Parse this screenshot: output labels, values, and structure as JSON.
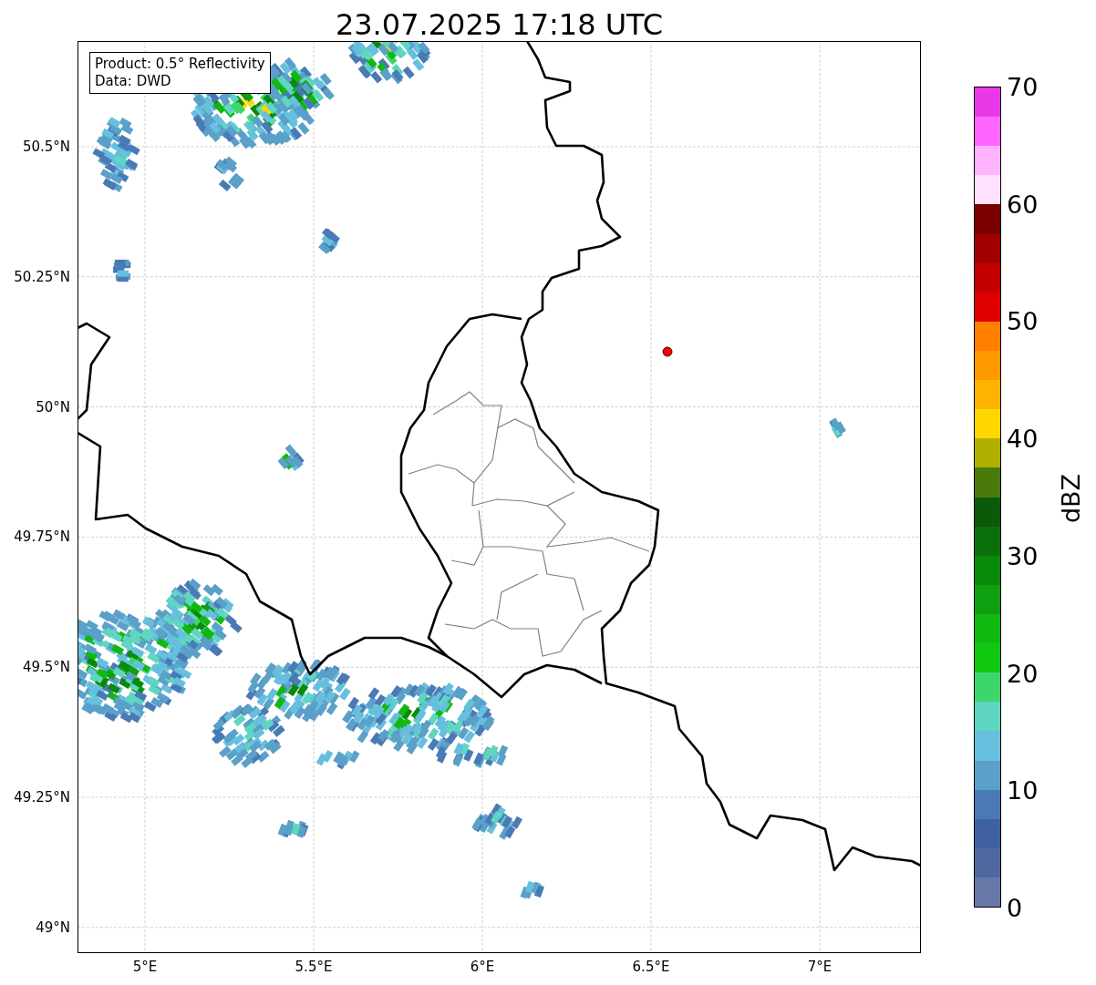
{
  "title": "23.07.2025 17:18 UTC",
  "info_box": [
    "Product: 0.5° Reflectivity",
    "Data: DWD"
  ],
  "map": {
    "yticks": [
      "50.5°N",
      "50.25°N",
      "50°N",
      "49.75°N",
      "49.5°N",
      "49.25°N",
      "49°N"
    ],
    "xticks": [
      "5°E",
      "5.5°E",
      "6°E",
      "6.5°E",
      "7°E"
    ]
  },
  "colorbar": {
    "label": "dBZ",
    "ticks": [
      "70",
      "60",
      "50",
      "40",
      "30",
      "20",
      "10",
      "0"
    ],
    "bands": [
      {
        "color": "#e838e8"
      },
      {
        "color": "#ff66ff"
      },
      {
        "color": "#ffb3ff"
      },
      {
        "color": "#ffe0ff"
      },
      {
        "color": "#7a0000"
      },
      {
        "color": "#a00000"
      },
      {
        "color": "#c20000"
      },
      {
        "color": "#e00000"
      },
      {
        "color": "#ff7f00"
      },
      {
        "color": "#ff9900"
      },
      {
        "color": "#ffb300"
      },
      {
        "color": "#ffd700"
      },
      {
        "color": "#b0b000"
      },
      {
        "color": "#4a7a0a"
      },
      {
        "color": "#0a5a0a"
      },
      {
        "color": "#0a700a"
      },
      {
        "color": "#0a8a0a"
      },
      {
        "color": "#0ea00e"
      },
      {
        "color": "#10b810"
      },
      {
        "color": "#10c810"
      },
      {
        "color": "#3dd66b"
      },
      {
        "color": "#5fd6c0"
      },
      {
        "color": "#66c0dd"
      },
      {
        "color": "#5aa0c8"
      },
      {
        "color": "#4a7ab5"
      },
      {
        "color": "#4060a0"
      },
      {
        "color": "#5068a0"
      },
      {
        "color": "#6878a8"
      }
    ]
  }
}
